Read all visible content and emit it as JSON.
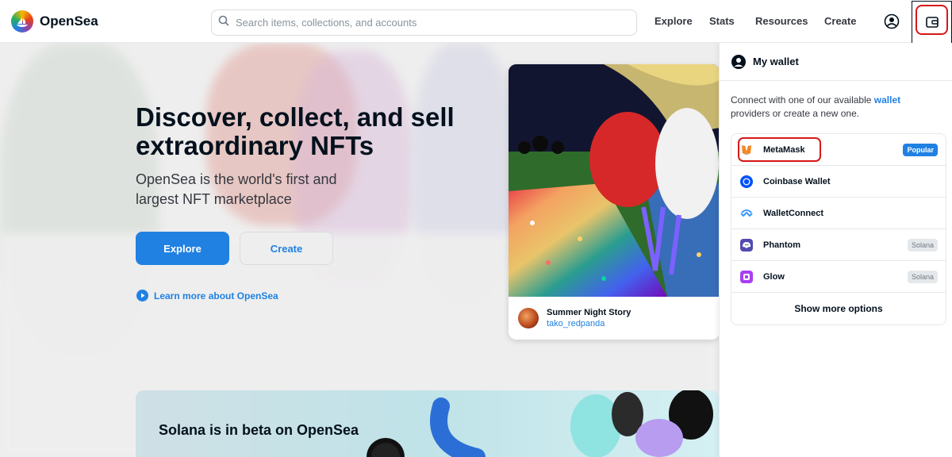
{
  "header": {
    "brand": "OpenSea",
    "search_placeholder": "Search items, collections, and accounts",
    "nav": [
      "Explore",
      "Stats",
      "Resources",
      "Create"
    ]
  },
  "hero": {
    "title": "Discover, collect, and sell extraordinary NFTs",
    "subtitle": "OpenSea is the world's first and largest NFT marketplace",
    "explore_label": "Explore",
    "create_label": "Create",
    "learn_more": "Learn more about OpenSea"
  },
  "featured": {
    "title": "Summer Night Story",
    "author": "tako_redpanda"
  },
  "banner": {
    "text": "Solana is in beta on OpenSea"
  },
  "wallet": {
    "title": "My wallet",
    "desc_before": "Connect with one of our available ",
    "desc_link": "wallet",
    "desc_after": " providers or create a new one.",
    "providers": [
      {
        "name": "MetaMask",
        "badge": "Popular",
        "icon": "metamask-fox-icon"
      },
      {
        "name": "Coinbase Wallet",
        "badge": "",
        "icon": "coinbase-icon"
      },
      {
        "name": "WalletConnect",
        "badge": "",
        "icon": "walletconnect-icon"
      },
      {
        "name": "Phantom",
        "badge": "Solana",
        "icon": "phantom-ghost-icon"
      },
      {
        "name": "Glow",
        "badge": "Solana",
        "icon": "glow-icon"
      }
    ],
    "show_more": "Show more options"
  },
  "colors": {
    "accent": "#2081e2",
    "highlight": "#d61818"
  }
}
